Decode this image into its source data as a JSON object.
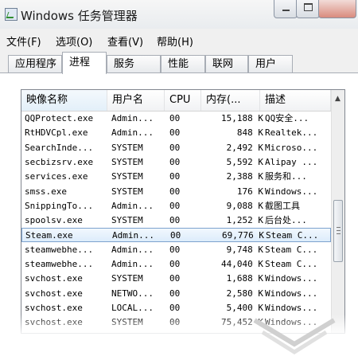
{
  "window": {
    "title": "Windows 任务管理器"
  },
  "menu": [
    {
      "label": "文件(F)"
    },
    {
      "label": "选项(O)"
    },
    {
      "label": "查看(V)"
    },
    {
      "label": "帮助(H)"
    }
  ],
  "tabs": [
    {
      "label": "应用程序"
    },
    {
      "label": "进程"
    },
    {
      "label": "服务"
    },
    {
      "label": "性能"
    },
    {
      "label": "联网"
    },
    {
      "label": "用户"
    }
  ],
  "active_tab": "进程",
  "table": {
    "columns": [
      "映像名称",
      "用户名",
      "CPU",
      "内存(...",
      "描述"
    ],
    "rows": [
      {
        "name": "QQProtect.exe",
        "user": "Admin...",
        "cpu": "00",
        "mem": "15,188 K",
        "desc": "QQ安全..."
      },
      {
        "name": "RtHDVCpl.exe",
        "user": "Admin...",
        "cpu": "00",
        "mem": "848 K",
        "desc": "Realtek..."
      },
      {
        "name": "SearchInde...",
        "user": "SYSTEM",
        "cpu": "00",
        "mem": "2,492 K",
        "desc": "Microso..."
      },
      {
        "name": "secbizsrv.exe",
        "user": "SYSTEM",
        "cpu": "00",
        "mem": "5,592 K",
        "desc": "Alipay ..."
      },
      {
        "name": "services.exe",
        "user": "SYSTEM",
        "cpu": "00",
        "mem": "2,388 K",
        "desc": "服务和..."
      },
      {
        "name": "smss.exe",
        "user": "SYSTEM",
        "cpu": "00",
        "mem": "176 K",
        "desc": "Windows..."
      },
      {
        "name": "SnippingTo...",
        "user": "Admin...",
        "cpu": "00",
        "mem": "9,088 K",
        "desc": "截图工具"
      },
      {
        "name": "spoolsv.exe",
        "user": "SYSTEM",
        "cpu": "00",
        "mem": "1,252 K",
        "desc": "后台处..."
      },
      {
        "name": "Steam.exe",
        "user": "Admin...",
        "cpu": "00",
        "mem": "69,776 K",
        "desc": "Steam C..."
      },
      {
        "name": "steamwebhe...",
        "user": "Admin...",
        "cpu": "00",
        "mem": "9,748 K",
        "desc": "Steam C..."
      },
      {
        "name": "steamwebhe...",
        "user": "Admin...",
        "cpu": "00",
        "mem": "44,040 K",
        "desc": "Steam C..."
      },
      {
        "name": "svchost.exe",
        "user": "SYSTEM",
        "cpu": "00",
        "mem": "1,688 K",
        "desc": "Windows..."
      },
      {
        "name": "svchost.exe",
        "user": "NETWO...",
        "cpu": "00",
        "mem": "2,580 K",
        "desc": "Windows..."
      },
      {
        "name": "svchost.exe",
        "user": "LOCAL...",
        "cpu": "00",
        "mem": "5,400 K",
        "desc": "Windows..."
      },
      {
        "name": "svchost.exe",
        "user": "SYSTEM",
        "cpu": "00",
        "mem": "75,452 K",
        "desc": "Windows..."
      }
    ],
    "selected_row": 8,
    "sort_icon": "sort-up-arrow-icon"
  },
  "icons": {
    "app": "task-manager-app-icon",
    "minimize": "minimize-icon",
    "maximize": "maximize-icon",
    "close": "close-icon",
    "scroll_up": "scroll-up-arrow-icon",
    "scroll_grip": "scroll-grip-icon"
  },
  "colors": {
    "selection_border": "#7da2ce",
    "selection_fill": "#dcecfb",
    "chrome": "#f0f0f0"
  }
}
